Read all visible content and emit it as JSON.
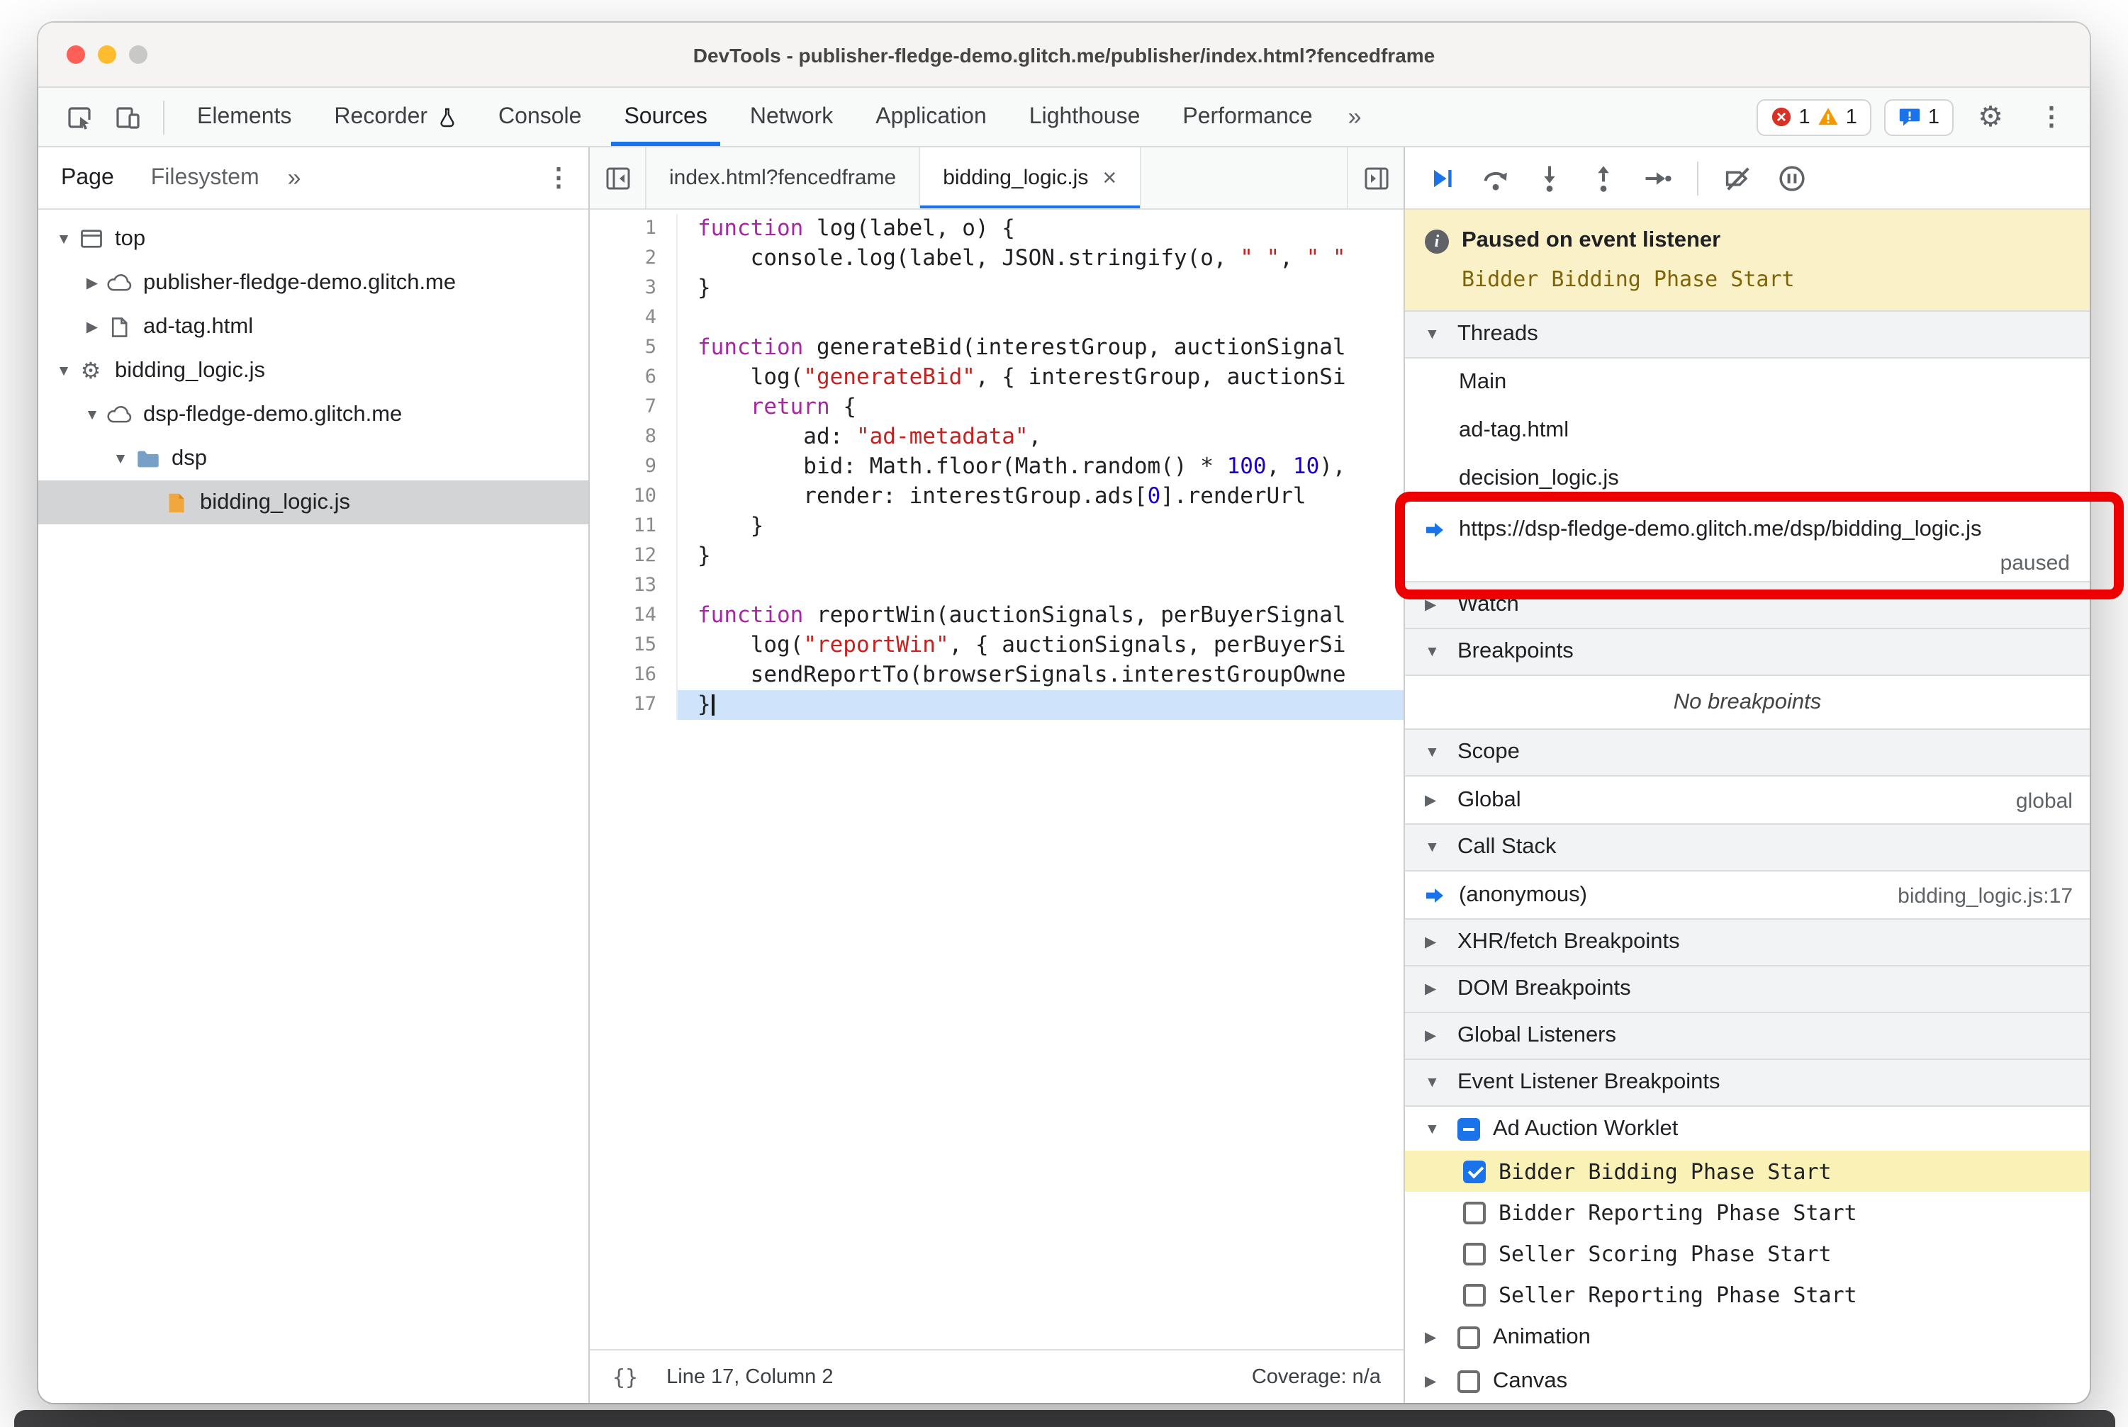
{
  "window": {
    "title": "DevTools - publisher-fledge-demo.glitch.me/publisher/index.html?fencedframe"
  },
  "icons": {
    "expanded": "▼",
    "collapsed": "▶",
    "overflow": "»",
    "kebab": "⋮",
    "gear": "⚙",
    "close": "×",
    "braces": "{}",
    "info": "i"
  },
  "colors": {
    "accent": "#1a73e8",
    "error": "#d93025",
    "warning": "#f29900",
    "annotation": "#ee0000",
    "paused_banner_bg": "#fbf1c8",
    "breakpoint_highlight": "#f9f1b5",
    "keyword": "#a626a4",
    "string": "#c5221f",
    "number": "#1c00cf"
  },
  "main_toolbar": {
    "tabs": [
      {
        "label": "Elements",
        "active": false
      },
      {
        "label": "Recorder",
        "active": false,
        "icon": "flask"
      },
      {
        "label": "Console",
        "active": false
      },
      {
        "label": "Sources",
        "active": true
      },
      {
        "label": "Network",
        "active": false
      },
      {
        "label": "Application",
        "active": false
      },
      {
        "label": "Lighthouse",
        "active": false
      },
      {
        "label": "Performance",
        "active": false
      }
    ],
    "error_count": "1",
    "warning_count": "1",
    "issue_count": "1"
  },
  "navigator": {
    "tabs": [
      {
        "label": "Page",
        "active": true
      },
      {
        "label": "Filesystem",
        "active": false
      }
    ],
    "tree": [
      {
        "label": "top",
        "level": 0,
        "icon": "frame",
        "disclosure": "expanded"
      },
      {
        "label": "publisher-fledge-demo.glitch.me",
        "level": 1,
        "icon": "cloud",
        "disclosure": "collapsed"
      },
      {
        "label": "ad-tag.html",
        "level": 1,
        "icon": "document",
        "disclosure": "collapsed"
      },
      {
        "label": "bidding_logic.js",
        "level": 0,
        "icon": "worker",
        "disclosure": "expanded"
      },
      {
        "label": "dsp-fledge-demo.glitch.me",
        "level": 1,
        "icon": "cloud",
        "disclosure": "expanded"
      },
      {
        "label": "dsp",
        "level": 2,
        "icon": "folder",
        "disclosure": "expanded"
      },
      {
        "label": "bidding_logic.js",
        "level": 3,
        "icon": "file-js",
        "disclosure": "none",
        "selected": true
      }
    ]
  },
  "editor": {
    "tabs": [
      {
        "label": "index.html?fencedframe",
        "active": false
      },
      {
        "label": "bidding_logic.js",
        "active": true,
        "closable": true
      }
    ],
    "lines": [
      {
        "n": 1,
        "t": [
          [
            "kw",
            "function"
          ],
          [
            "pl",
            " log(label, o) {"
          ]
        ]
      },
      {
        "n": 2,
        "t": [
          [
            "pl",
            "    console.log(label, JSON.stringify(o, "
          ],
          [
            "str",
            "\" \""
          ],
          [
            "pl",
            ", "
          ],
          [
            "str",
            "\" \""
          ]
        ]
      },
      {
        "n": 3,
        "t": [
          [
            "pl",
            "}"
          ]
        ]
      },
      {
        "n": 4,
        "t": []
      },
      {
        "n": 5,
        "t": [
          [
            "kw",
            "function"
          ],
          [
            "pl",
            " generateBid(interestGroup, auctionSignal"
          ]
        ]
      },
      {
        "n": 6,
        "t": [
          [
            "pl",
            "    log("
          ],
          [
            "str",
            "\"generateBid\""
          ],
          [
            "pl",
            ", { interestGroup, auctionSi"
          ]
        ]
      },
      {
        "n": 7,
        "t": [
          [
            "pl",
            "    "
          ],
          [
            "kw",
            "return"
          ],
          [
            "pl",
            " {"
          ]
        ]
      },
      {
        "n": 8,
        "t": [
          [
            "pl",
            "        ad: "
          ],
          [
            "str",
            "\"ad-metadata\""
          ],
          [
            "pl",
            ","
          ]
        ]
      },
      {
        "n": 9,
        "t": [
          [
            "pl",
            "        bid: Math.floor(Math.random() * "
          ],
          [
            "num",
            "100"
          ],
          [
            "pl",
            ", "
          ],
          [
            "num",
            "10"
          ],
          [
            "pl",
            "),"
          ]
        ]
      },
      {
        "n": 10,
        "t": [
          [
            "pl",
            "        render: interestGroup.ads["
          ],
          [
            "num",
            "0"
          ],
          [
            "pl",
            "].renderUrl"
          ]
        ]
      },
      {
        "n": 11,
        "t": [
          [
            "pl",
            "    }"
          ]
        ]
      },
      {
        "n": 12,
        "t": [
          [
            "pl",
            "}"
          ]
        ]
      },
      {
        "n": 13,
        "t": []
      },
      {
        "n": 14,
        "t": [
          [
            "kw",
            "function"
          ],
          [
            "pl",
            " reportWin(auctionSignals, perBuyerSignal"
          ]
        ]
      },
      {
        "n": 15,
        "t": [
          [
            "pl",
            "    log("
          ],
          [
            "str",
            "\"reportWin\""
          ],
          [
            "pl",
            ", { auctionSignals, perBuyerSi"
          ]
        ]
      },
      {
        "n": 16,
        "t": [
          [
            "pl",
            "    sendReportTo(browserSignals.interestGroupOwne"
          ]
        ]
      },
      {
        "n": 17,
        "t": [
          [
            "pl",
            "}"
          ]
        ],
        "current": true
      }
    ],
    "status": {
      "position": "Line 17, Column 2",
      "coverage": "Coverage: n/a"
    }
  },
  "debugger": {
    "paused_banner": {
      "title": "Paused on event listener",
      "detail": "Bidder Bidding Phase Start"
    },
    "threads": {
      "header": "Threads",
      "items": [
        {
          "label": "Main"
        },
        {
          "label": "ad-tag.html"
        },
        {
          "label": "decision_logic.js"
        },
        {
          "label": "https://dsp-fledge-demo.glitch.me/dsp/bidding_logic.js",
          "status": "paused",
          "current": true
        }
      ]
    },
    "watch": {
      "header": "Watch"
    },
    "breakpoints": {
      "header": "Breakpoints",
      "empty": "No breakpoints"
    },
    "scope": {
      "header": "Scope",
      "rows": [
        {
          "label": "Global",
          "value": "global"
        }
      ]
    },
    "call_stack": {
      "header": "Call Stack",
      "frames": [
        {
          "label": "(anonymous)",
          "location": "bidding_logic.js:17",
          "current": true
        }
      ]
    },
    "xhr": {
      "header": "XHR/fetch Breakpoints"
    },
    "dom": {
      "header": "DOM Breakpoints"
    },
    "global_listeners": {
      "header": "Global Listeners"
    },
    "event_listener_breakpoints": {
      "header": "Event Listener Breakpoints",
      "groups": [
        {
          "label": "Ad Auction Worklet",
          "state": "indeterminate",
          "disclosure": "expanded",
          "children": [
            {
              "label": "Bidder Bidding Phase Start",
              "checked": true,
              "highlight": true
            },
            {
              "label": "Bidder Reporting Phase Start",
              "checked": false
            },
            {
              "label": "Seller Scoring Phase Start",
              "checked": false
            },
            {
              "label": "Seller Reporting Phase Start",
              "checked": false
            }
          ]
        },
        {
          "label": "Animation",
          "state": "unchecked",
          "disclosure": "collapsed",
          "children": []
        },
        {
          "label": "Canvas",
          "state": "unchecked",
          "disclosure": "collapsed",
          "children": []
        }
      ]
    }
  }
}
